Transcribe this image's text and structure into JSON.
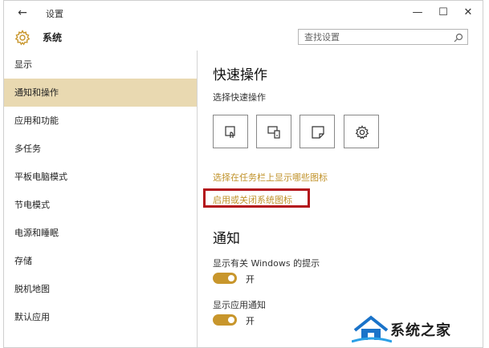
{
  "window": {
    "title": "设置",
    "back_icon": "arrow-left-icon",
    "minimize_glyph": "—",
    "maximize_glyph": "☐",
    "close_glyph": "✕"
  },
  "header": {
    "title": "系统",
    "icon": "gear-icon",
    "search_placeholder": "查找设置"
  },
  "sidebar": {
    "items": [
      {
        "label": "显示",
        "active": false
      },
      {
        "label": "通知和操作",
        "active": true
      },
      {
        "label": "应用和功能",
        "active": false
      },
      {
        "label": "多任务",
        "active": false
      },
      {
        "label": "平板电脑模式",
        "active": false
      },
      {
        "label": "节电模式",
        "active": false
      },
      {
        "label": "电源和睡眠",
        "active": false
      },
      {
        "label": "存储",
        "active": false
      },
      {
        "label": "脱机地图",
        "active": false
      },
      {
        "label": "默认应用",
        "active": false
      }
    ]
  },
  "main": {
    "quick_actions_title": "快速操作",
    "quick_actions_sub": "选择快速操作",
    "quick_action_tiles": [
      "tablet-mode-icon",
      "connect-icon",
      "note-icon",
      "settings-icon"
    ],
    "link_taskbar_icons": "选择在任务栏上显示哪些图标",
    "link_system_icons": "启用或关闭系统图标",
    "notifications_title": "通知",
    "notify_windows_tips_label": "显示有关 Windows 的提示",
    "notify_windows_tips_state": "开",
    "notify_app_label": "显示应用通知",
    "notify_app_state": "开"
  },
  "colors": {
    "accent": "#c8962c",
    "sidebar_active": "#e9d9b1",
    "highlight_border": "#b3121a"
  },
  "watermark": {
    "text": "系统之家"
  }
}
